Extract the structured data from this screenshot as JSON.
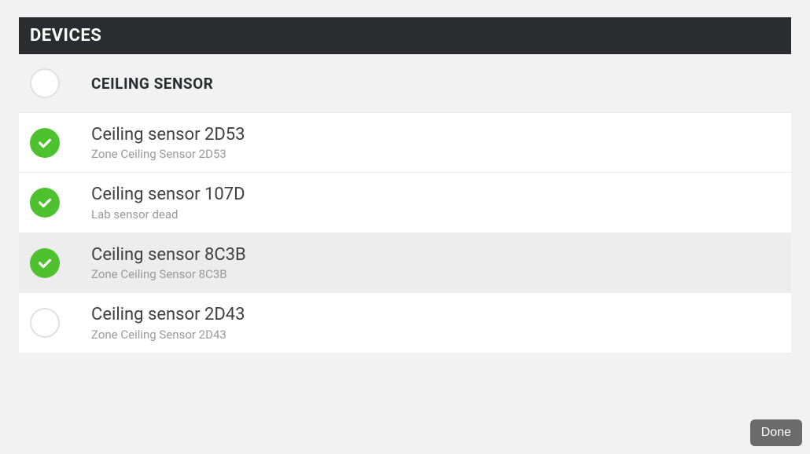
{
  "header": {
    "title": "DEVICES"
  },
  "group": {
    "title": "CEILING SENSOR"
  },
  "devices": [
    {
      "name": "Ceiling sensor 2D53",
      "subtitle": "Zone Ceiling Sensor 2D53",
      "checked": true,
      "highlighted": false
    },
    {
      "name": "Ceiling sensor 107D",
      "subtitle": "Lab sensor dead",
      "checked": true,
      "highlighted": false
    },
    {
      "name": "Ceiling sensor 8C3B",
      "subtitle": "Zone Ceiling Sensor 8C3B",
      "checked": true,
      "highlighted": true
    },
    {
      "name": "Ceiling sensor 2D43",
      "subtitle": "Zone Ceiling Sensor 2D43",
      "checked": false,
      "highlighted": false
    }
  ],
  "buttons": {
    "done": "Done"
  }
}
